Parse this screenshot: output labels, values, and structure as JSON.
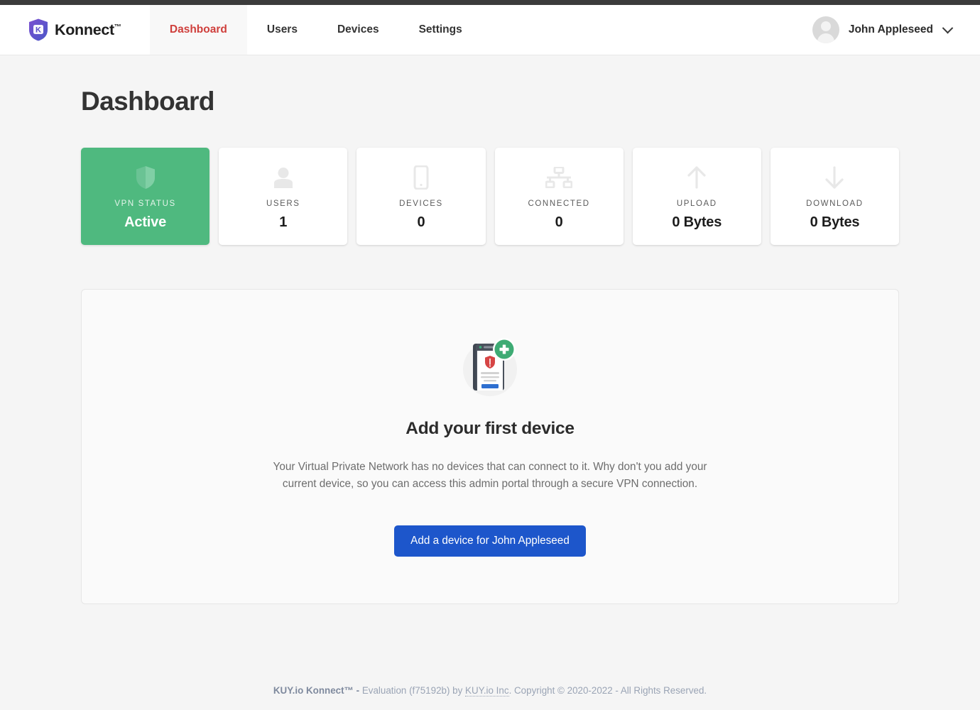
{
  "brand": {
    "name": "Konnect",
    "tm": "™",
    "logo_icon": "shield-k-icon"
  },
  "nav": {
    "items": [
      {
        "label": "Dashboard",
        "active": true
      },
      {
        "label": "Users",
        "active": false
      },
      {
        "label": "Devices",
        "active": false
      },
      {
        "label": "Settings",
        "active": false
      }
    ]
  },
  "account": {
    "name": "John Appleseed",
    "avatar_icon": "user-avatar-icon",
    "caret_icon": "chevron-down-icon"
  },
  "page": {
    "title": "Dashboard"
  },
  "stats": [
    {
      "label": "VPN STATUS",
      "value": "Active",
      "icon": "shield-icon",
      "accent": "#4fb97f"
    },
    {
      "label": "USERS",
      "value": "1",
      "icon": "user-icon",
      "accent": ""
    },
    {
      "label": "DEVICES",
      "value": "0",
      "icon": "mobile-icon",
      "accent": ""
    },
    {
      "label": "CONNECTED",
      "value": "0",
      "icon": "network-icon",
      "accent": ""
    },
    {
      "label": "UPLOAD",
      "value": "0 Bytes",
      "icon": "arrow-up-icon",
      "accent": ""
    },
    {
      "label": "DOWNLOAD",
      "value": "0 Bytes",
      "icon": "arrow-down-icon",
      "accent": ""
    }
  ],
  "empty_state": {
    "illustration_icon": "add-device-illustration",
    "title": "Add your first device",
    "description": "Your Virtual Private Network has no devices that can connect to it. Why don't you add your current device, so you can access this admin portal through a secure VPN connection.",
    "button_label": "Add a device for John Appleseed",
    "button_color": "#1d56cb"
  },
  "footer": {
    "product": "KUY.io Konnect™ -",
    "text_before": " Evaluation (f75192b) by ",
    "company": "KUY.io Inc",
    "text_after": ". Copyright © 2020-2022 - All Rights Reserved."
  }
}
